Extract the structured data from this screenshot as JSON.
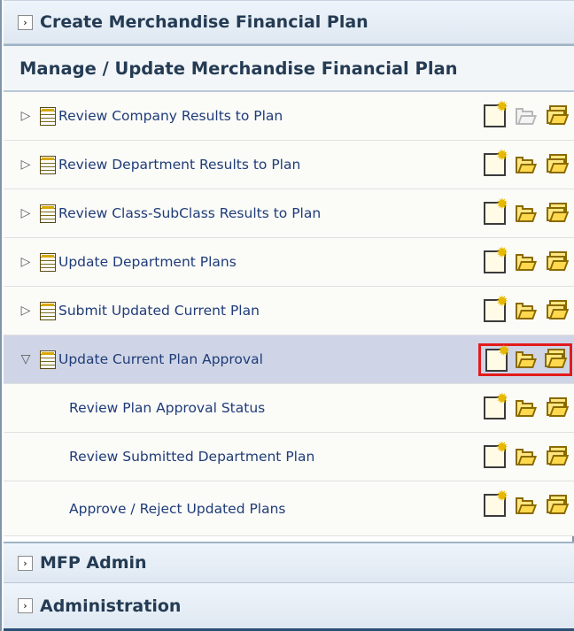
{
  "sections": {
    "create": {
      "title": "Create Merchandise Financial Plan",
      "chevron": "›"
    },
    "manage": {
      "title": "Manage / Update Merchandise Financial Plan"
    },
    "mfp_admin": {
      "title": "MFP Admin",
      "chevron": "›"
    },
    "administration": {
      "title": "Administration",
      "chevron": "›"
    }
  },
  "tasks": [
    {
      "label": "Review Company Results to Plan",
      "expand_icon": "▷",
      "open_disabled": true
    },
    {
      "label": "Review Department Results to Plan",
      "expand_icon": "▷"
    },
    {
      "label": "Review Class-SubClass Results to Plan",
      "expand_icon": "▷"
    },
    {
      "label": "Update Department Plans",
      "expand_icon": "▷"
    },
    {
      "label": "Submit Updated Current Plan",
      "expand_icon": "▷"
    },
    {
      "label": "Update Current Plan Approval",
      "expand_icon": "▽",
      "selected": true,
      "highlighted_actions": true
    }
  ],
  "subtasks": [
    {
      "label": "Review Plan Approval Status"
    },
    {
      "label": "Review Submitted Department Plan"
    },
    {
      "label": "Approve / Reject Updated Plans"
    }
  ],
  "icons": {
    "create": "new-workbook-icon",
    "open": "open-workbook-icon",
    "multi": "open-multiple-workbooks-icon",
    "task": "task-list-icon"
  },
  "colors": {
    "header_text": "#243b53",
    "link_text": "#1f3c78",
    "selected_row": "#cfd5e6",
    "highlight_box": "#e31b1b"
  }
}
